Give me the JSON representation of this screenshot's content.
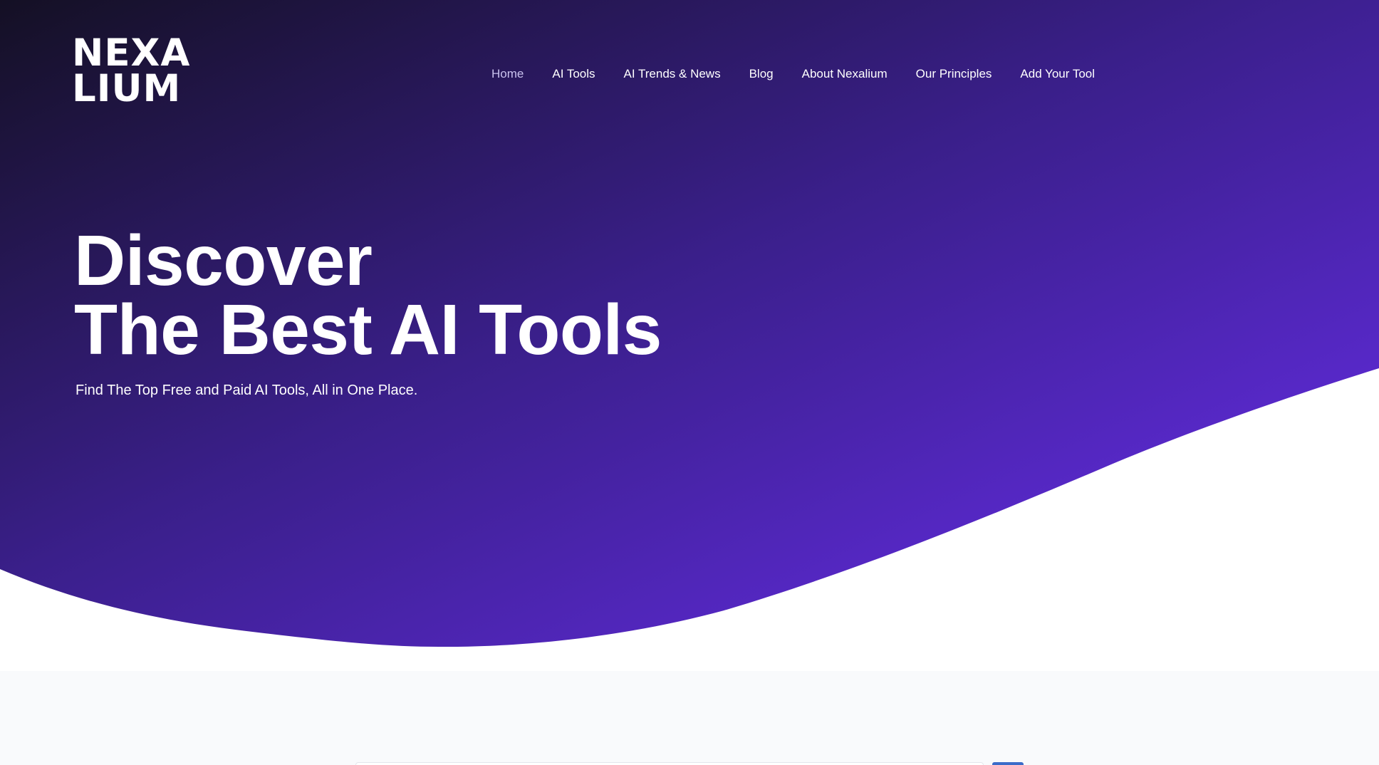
{
  "brand": {
    "logo_line1": "NEXA",
    "logo_line2": "LIUM"
  },
  "nav": {
    "items": [
      {
        "label": "Home",
        "active": true
      },
      {
        "label": "AI Tools"
      },
      {
        "label": "AI Trends & News"
      },
      {
        "label": "Blog"
      },
      {
        "label": "About Nexalium"
      },
      {
        "label": "Our Principles"
      },
      {
        "label": "Add Your Tool"
      }
    ]
  },
  "hero": {
    "title_line1": "Discover",
    "title_line2": "The Best AI Tools",
    "subtitle": "Find The Top Free and Paid AI Tools, All in One Place."
  },
  "colors": {
    "hero_gradient_start": "#141024",
    "hero_gradient_mid": "#3a1f8a",
    "hero_gradient_end": "#6a2ef0",
    "section_bg": "#f9fafc",
    "button_blue": "#3c6cc9"
  }
}
